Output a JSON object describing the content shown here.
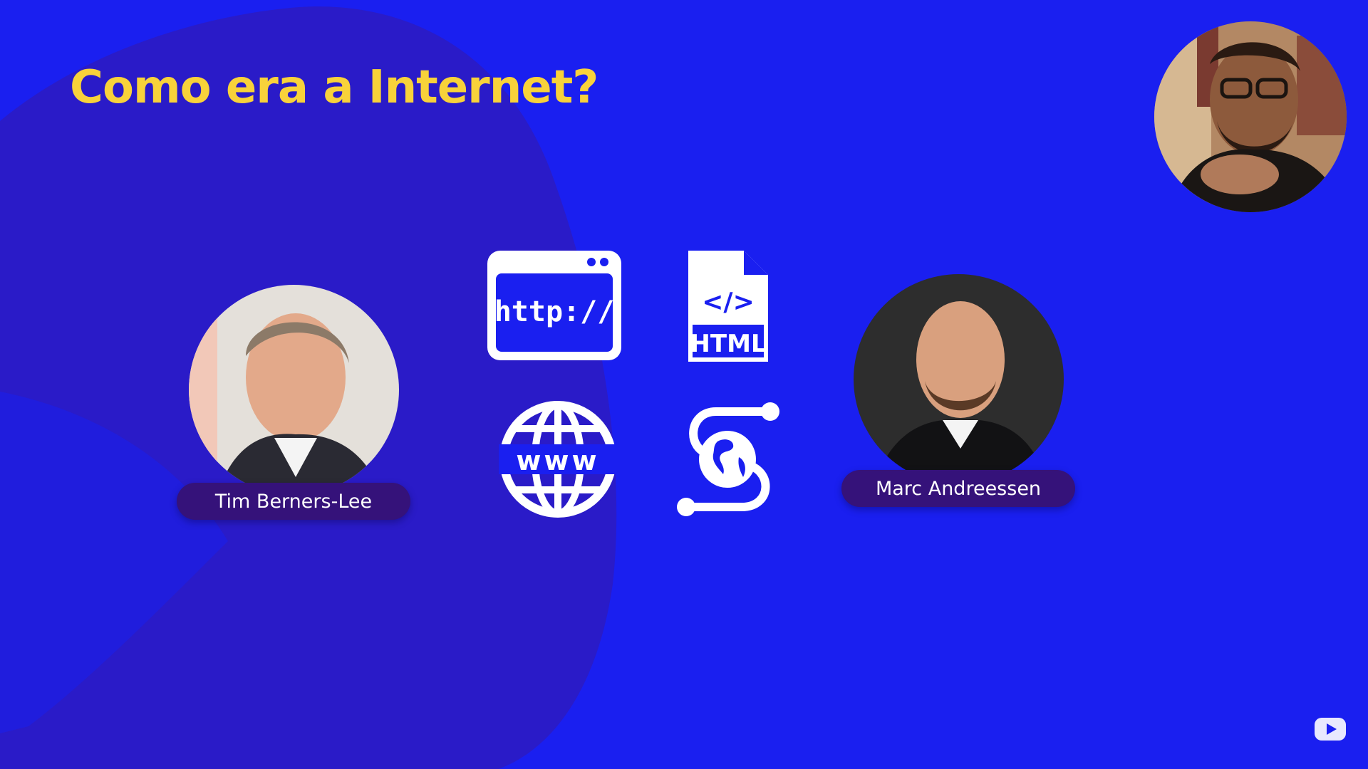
{
  "slide": {
    "title": "Como era a Internet?",
    "colors": {
      "background": "#1a1ff0",
      "blob": "#2a1bc8",
      "title": "#f8d23a",
      "pill": "#35127a"
    }
  },
  "people": {
    "left": {
      "name": "Tim Berners-Lee",
      "photo": "portrait-photo"
    },
    "right": {
      "name": "Marc Andreessen",
      "photo": "portrait-photo"
    }
  },
  "icons": {
    "http": {
      "text": "http://",
      "name": "browser-window-http-icon"
    },
    "html": {
      "code": "</>",
      "label": "HTML",
      "name": "html-file-icon"
    },
    "www": {
      "text": "www",
      "name": "www-globe-icon"
    },
    "network": {
      "name": "globe-network-icon"
    }
  },
  "presenter": {
    "name": "presenter-webcam"
  },
  "overlay": {
    "icon": "video-player-logo-icon"
  }
}
